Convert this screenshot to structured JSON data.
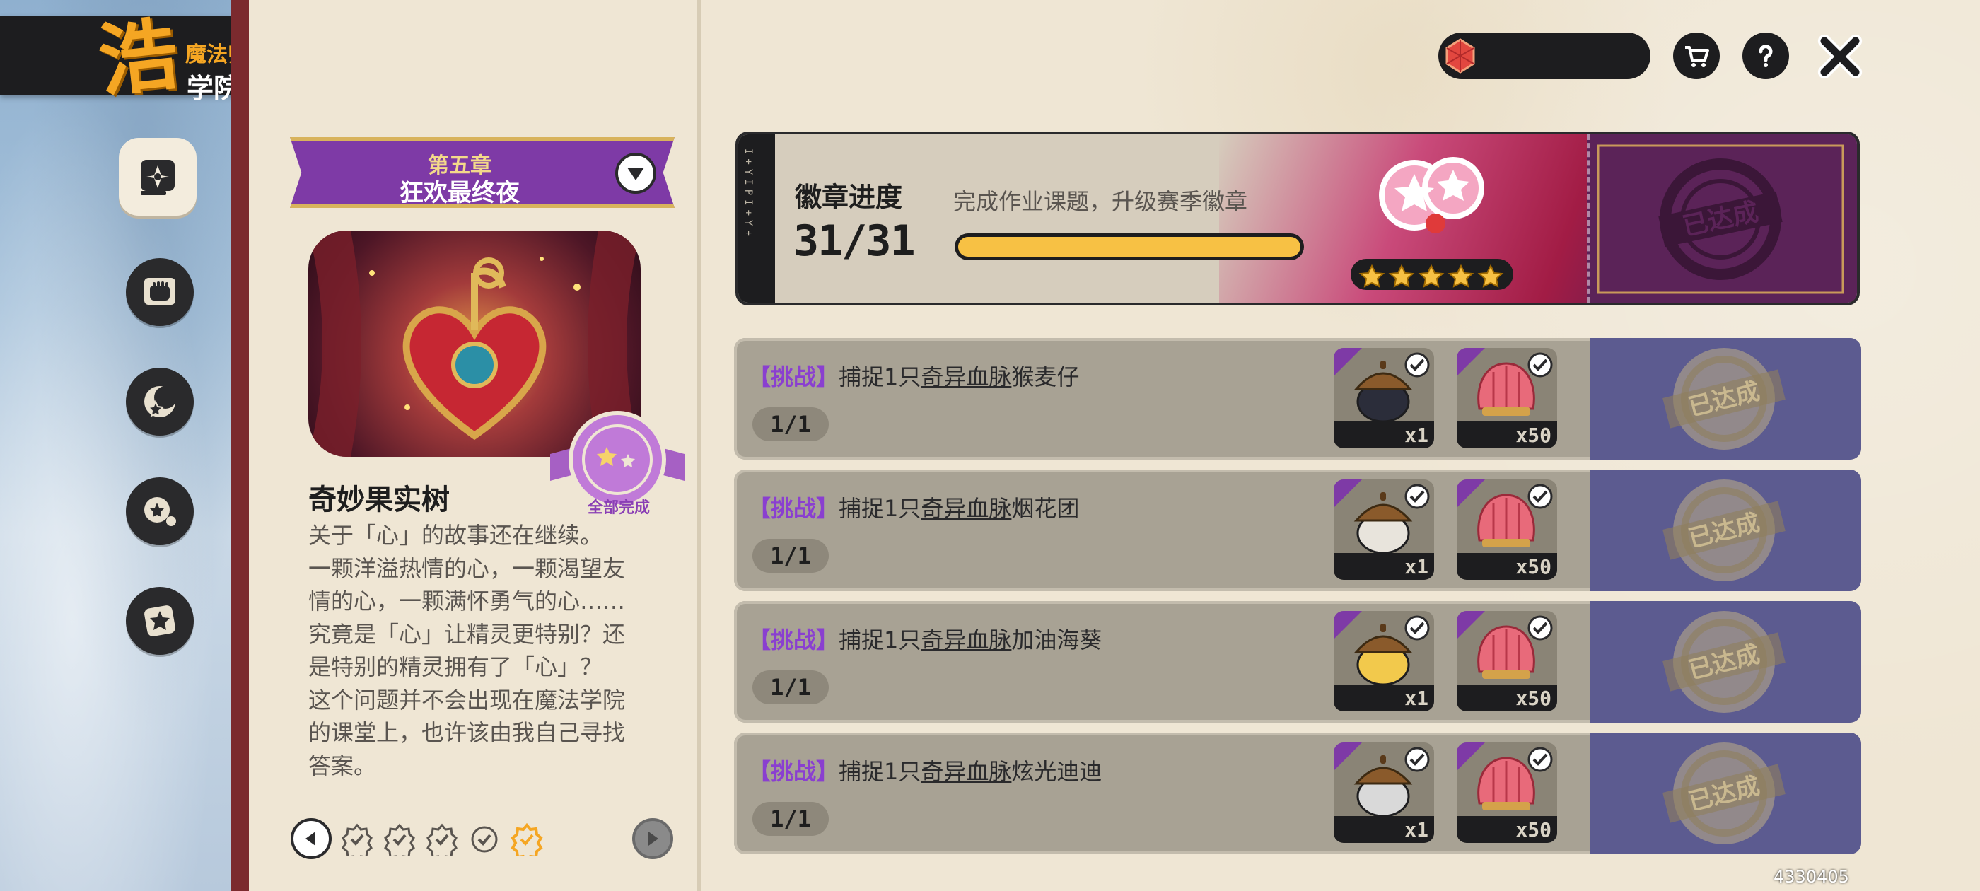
{
  "logo": {
    "subtitle": "魔法师手册",
    "title": "学院作业"
  },
  "nav": {
    "items": [
      {
        "id": "homework",
        "icon": "book-compass-icon"
      },
      {
        "id": "fist",
        "icon": "fist-icon"
      },
      {
        "id": "moon-star",
        "icon": "moon-star-icon"
      },
      {
        "id": "star-orb",
        "icon": "star-orb-icon"
      },
      {
        "id": "star-card",
        "icon": "star-card-icon"
      }
    ]
  },
  "chapter": {
    "number": "第五章",
    "name": "狂欢最终夜",
    "seal_label": "全部完成",
    "story_title": "奇妙果实树",
    "story_lines": [
      "关于「心」的故事还在继续。",
      "一颗洋溢热情的心，一颗渴望友",
      "情的心，一颗满怀勇气的心……",
      "究竟是「心」让精灵更特别？还",
      "是特别的精灵拥有了「心」？",
      "这个问题并不会出现在魔法学院",
      "的课堂上，也许该由我自己寻找",
      "答案。"
    ]
  },
  "pager": {
    "dots": [
      "completed",
      "completed",
      "completed",
      "completed",
      "current"
    ]
  },
  "hud": {
    "currency_icon": "red-gem-icon",
    "shop_icon": "cart-icon",
    "help_icon": "question-icon",
    "close_icon": "close-icon"
  },
  "badge": {
    "strip_text": "I+YIPI+Y+",
    "title": "徽章进度",
    "description": "完成作业课题，升级赛季徽章",
    "progress_text": "31/31",
    "progress": 1.0,
    "stars": 5,
    "stamp_text": "已达成"
  },
  "tasks": [
    {
      "tag": "【挑战】",
      "prefix": "捕捉1只",
      "underlined": "奇异血脉",
      "suffix": "猴麦仔",
      "progress": "1/1",
      "rewards": [
        {
          "qty": "x1",
          "kind": "acorn-black"
        },
        {
          "qty": "x50",
          "kind": "shell-pink"
        }
      ],
      "stamp_text": "已达成"
    },
    {
      "tag": "【挑战】",
      "prefix": "捕捉1只",
      "underlined": "奇异血脉",
      "suffix": "烟花团",
      "progress": "1/1",
      "rewards": [
        {
          "qty": "x1",
          "kind": "acorn-white"
        },
        {
          "qty": "x50",
          "kind": "shell-pink"
        }
      ],
      "stamp_text": "已达成"
    },
    {
      "tag": "【挑战】",
      "prefix": "捕捉1只",
      "underlined": "奇异血脉",
      "suffix": "加油海葵",
      "progress": "1/1",
      "rewards": [
        {
          "qty": "x1",
          "kind": "acorn-yellow"
        },
        {
          "qty": "x50",
          "kind": "shell-pink"
        }
      ],
      "stamp_text": "已达成"
    },
    {
      "tag": "【挑战】",
      "prefix": "捕捉1只",
      "underlined": "奇异血脉",
      "suffix": "炫光迪迪",
      "progress": "1/1",
      "rewards": [
        {
          "qty": "x1",
          "kind": "acorn-silver"
        },
        {
          "qty": "x50",
          "kind": "shell-pink"
        }
      ],
      "stamp_text": "已达成"
    }
  ],
  "version": "4330405",
  "colors": {
    "accent_purple": "#7e3aa6",
    "gold": "#f7c144",
    "dark": "#1d1d1f",
    "paper": "#efe6d4"
  }
}
